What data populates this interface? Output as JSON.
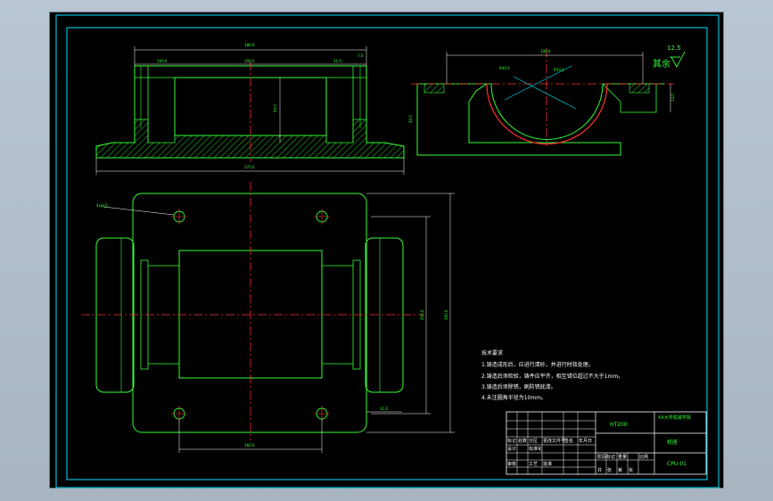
{
  "drawing": {
    "colors": {
      "background": "#000000",
      "frame": "#00e5ff",
      "outline": "#33ff33",
      "centerline": "#ff3030",
      "text": "#ffffff",
      "window": "#b9c6d2"
    },
    "dimensions": {
      "front_top_overall": "188.0",
      "front_top_left": "100.0",
      "front_top_mid": "100.0",
      "front_top_right": "31.0",
      "front_top_small": "7.0",
      "front_height": "94.0",
      "front_base": "270.0",
      "side_top": "108.0",
      "side_radius_1": "R40.0",
      "side_radius_2": "R50.0",
      "side_height": "40.0",
      "side_small": "14.0",
      "plan_hole": "4xφ10",
      "plan_inner_height": "200.0",
      "plan_outer_height": "300.0",
      "plan_offset": "31.0",
      "plan_bottom": "160.0"
    },
    "roughness": {
      "label": "其余",
      "value": "12.5"
    },
    "tech_requirements": {
      "title": "技术要求",
      "items": [
        "1.铸造成形后，应进行清砂，并进行时效处理。",
        "2.铸造后须检验，铸件应平齐，相互错位超过不大于1mm。",
        "3.铸造后须除锈，刷防锈底漆。",
        "4.未注圆角半径为10mm。"
      ]
    },
    "title_block": {
      "material": "HT200",
      "school": "XX大学机械学院",
      "part_name": "机座",
      "drawing_no": "CPU-01",
      "labels": [
        "标记",
        "处数",
        "分区",
        "更改文件号",
        "签名",
        "年月日"
      ],
      "row2": [
        "设计",
        "标准化"
      ],
      "row3": [
        "审核",
        "",
        "工艺",
        "批准"
      ],
      "stage_labels": [
        "阶段标记",
        "重量",
        "比例"
      ],
      "sheet_labels": [
        "共",
        "张",
        "第",
        "张"
      ]
    }
  }
}
